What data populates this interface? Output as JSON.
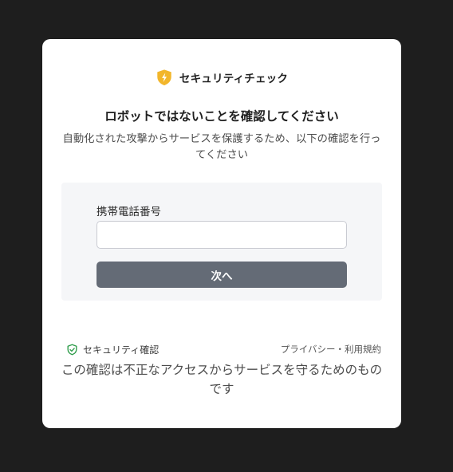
{
  "brand": {
    "name": "セキュリティチェック",
    "icon": "shield-lightning-icon",
    "icon_color": "#f2b62b"
  },
  "heading": {
    "title": "ロボットではないことを確認してください",
    "subtitle": "自動化された攻撃からサービスを保護するため、以下の確認を行ってください"
  },
  "form": {
    "phone_label": "携帯電話番号",
    "phone_value": "",
    "phone_placeholder": "",
    "next_label": "次へ",
    "button_color": "#646b76"
  },
  "footer": {
    "security_label": "セキュリティ確認",
    "security_icon": "shield-check-icon",
    "security_icon_color": "#2e9c4a",
    "links_text": "プライバシー・利用規約",
    "notice": "この確認は不正なアクセスからサービスを守るためのものです"
  }
}
